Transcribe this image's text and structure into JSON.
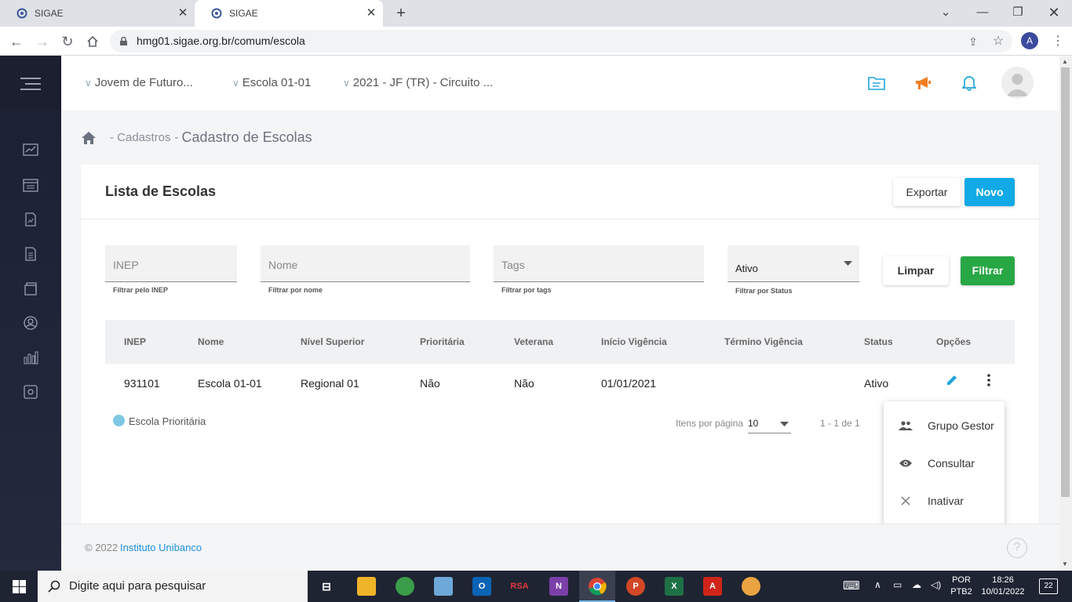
{
  "browser": {
    "tabs": [
      {
        "title": "SIGAE"
      },
      {
        "title": "SIGAE"
      }
    ],
    "url": "hmg01.sigae.org.br/comum/escola",
    "profile_initial": "A"
  },
  "header": {
    "selectors": [
      "Jovem de Futuro...",
      "Escola 01-01",
      "2021 - JF (TR) - Circuito ..."
    ]
  },
  "breadcrumb": {
    "section": "- Cadastros",
    "separator": "-",
    "page": "Cadastro de Escolas"
  },
  "card": {
    "title": "Lista de Escolas",
    "export_label": "Exportar",
    "new_label": "Novo"
  },
  "filters": {
    "inep_placeholder": "INEP",
    "inep_hint": "Filtrar pelo INEP",
    "nome_placeholder": "Nome",
    "nome_hint": "Filtrar por nome",
    "tags_placeholder": "Tags",
    "tags_hint": "Filtrar por tags",
    "status_value": "Ativo",
    "status_hint": "Filtrar por Status",
    "clear_label": "Limpar",
    "filter_label": "Filtrar"
  },
  "table": {
    "headers": [
      "INEP",
      "Nome",
      "Nível Superior",
      "Prioritária",
      "Veterana",
      "Início Vigência",
      "Término Vigência",
      "Status",
      "Opções"
    ],
    "rows": [
      {
        "inep": "931101",
        "nome": "Escola 01-01",
        "nivel": "Regional 01",
        "prioritaria": "Não",
        "veterana": "Não",
        "inicio": "01/01/2021",
        "termino": "",
        "status": "Ativo"
      }
    ]
  },
  "legend": {
    "label": "Escola Prioritária",
    "color": "#7ec8e3"
  },
  "pagination": {
    "items_label": "Itens por página",
    "per_page": "10",
    "range": "1 - 1 de 1"
  },
  "options_menu": {
    "items": [
      "Grupo Gestor",
      "Consultar",
      "Inativar"
    ]
  },
  "footer": {
    "copyright": "© 2022",
    "link": "Instituto Unibanco"
  },
  "taskbar": {
    "search_placeholder": "Digite aqui para pesquisar",
    "lang": "POR",
    "layout": "PTB2",
    "time": "18:26",
    "date": "10/01/2022",
    "notifications": "22",
    "rsa_label": "RSA"
  },
  "colors": {
    "primary": "#11a9e6",
    "success": "#28a745",
    "accent": "#f47d20",
    "sidebar": "#1e2336"
  }
}
